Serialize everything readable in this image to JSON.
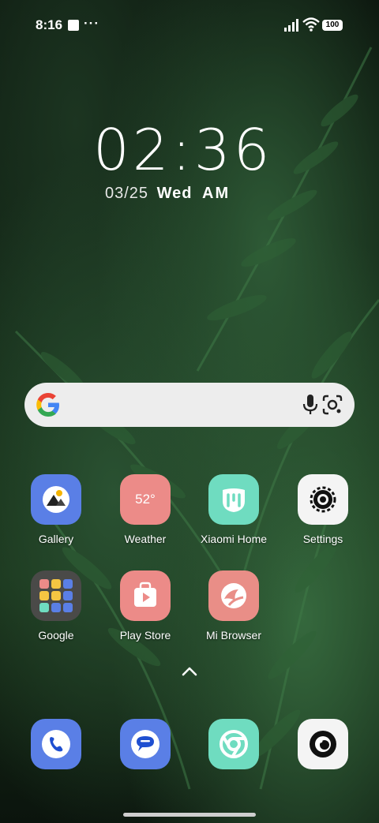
{
  "status_bar": {
    "time": "8:16",
    "dots": "···",
    "battery": "100",
    "icons": [
      "notification-square-icon",
      "signal-icon",
      "wifi-icon",
      "battery-icon"
    ]
  },
  "clock_widget": {
    "time": "02:36",
    "date": "03/25",
    "weekday": "Wed",
    "ampm": "AM"
  },
  "search_bar": {
    "icons": [
      "google-g-icon",
      "mic-icon",
      "google-lens-icon"
    ]
  },
  "apps": [
    {
      "label": "Gallery",
      "icon": "gallery-icon",
      "color": "#5a7fe6"
    },
    {
      "label": "Weather",
      "icon_text": "52°",
      "color": "#ec8b88"
    },
    {
      "label": "Xiaomi Home",
      "icon": "xiaomi-home-icon",
      "color": "#6fdcc0"
    },
    {
      "label": "Settings",
      "icon": "gear-icon",
      "color": "#f4f4f4"
    },
    {
      "label": "Google",
      "icon": "folder-icon",
      "color": "#4a4a48"
    },
    {
      "label": "Play Store",
      "icon": "play-store-icon",
      "color": "#ec8b88"
    },
    {
      "label": "Mi Browser",
      "icon": "mi-browser-icon",
      "color": "#e98e87"
    }
  ],
  "dock": [
    {
      "name": "phone",
      "icon": "phone-icon",
      "color": "#5a7fe6"
    },
    {
      "name": "messages",
      "icon": "messages-icon",
      "color": "#5a7fe6"
    },
    {
      "name": "chrome",
      "icon": "chrome-icon",
      "color": "#6fdcc0"
    },
    {
      "name": "camera",
      "icon": "camera-icon",
      "color": "#f4f4f4"
    }
  ]
}
